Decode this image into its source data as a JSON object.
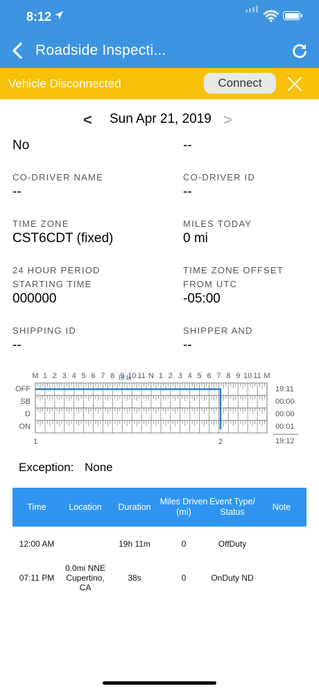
{
  "status_bar": {
    "time": "8:12"
  },
  "nav": {
    "title": "Roadside Inspecti..."
  },
  "banner": {
    "text": "Vehicle Disconnected",
    "connect_label": "Connect"
  },
  "date_nav": {
    "prev": "<",
    "date": "Sun Apr 21, 2019",
    "next": ">"
  },
  "fields": {
    "top_left_value": "No",
    "top_right_value": "--",
    "co_driver_name": {
      "label": "CO-DRIVER NAME",
      "value": "--"
    },
    "co_driver_id": {
      "label": "CO-DRIVER ID",
      "value": "--"
    },
    "time_zone": {
      "label": "TIME ZONE",
      "value": "CST6CDT (fixed)"
    },
    "miles_today": {
      "label": "MILES TODAY",
      "value": "0 mi"
    },
    "period_start": {
      "label1": "24 HOUR PERIOD",
      "label2": "STARTING TIME",
      "value": "000000"
    },
    "tz_offset": {
      "label1": "TIME ZONE OFFSET",
      "label2": "FROM UTC",
      "value": "-05:00"
    },
    "shipping_id": {
      "label": "SHIPPING ID",
      "value": "--"
    },
    "shipper": {
      "label": "SHIPPER AND",
      "value": "--"
    }
  },
  "graph": {
    "hour_labels": [
      "M",
      "1",
      "2",
      "3",
      "4",
      "5",
      "6",
      "7",
      "8",
      "9",
      "10",
      "11",
      "N",
      "1",
      "2",
      "3",
      "4",
      "5",
      "6",
      "7",
      "8",
      "9",
      "10",
      "11",
      "M"
    ],
    "rows": [
      "OFF",
      "SB",
      "D",
      "ON"
    ],
    "totals": [
      "19:11",
      "00:00",
      "00:00",
      "00:01"
    ],
    "total_sum": "19:12",
    "marker_label": "19:11",
    "markers": [
      "1",
      "2"
    ],
    "line_color": "#2a7bc8"
  },
  "exception": {
    "label": "Exception:",
    "value": "None"
  },
  "table": {
    "headers": [
      "Time",
      "Location",
      "Duration",
      "Miles Driven (mi)",
      "Event Type/ Status",
      "Note"
    ],
    "rows": [
      {
        "time": "12:00 AM",
        "location": "",
        "duration": "19h 11m",
        "miles": "0",
        "event": "OffDuty",
        "note": ""
      },
      {
        "time": "07:11 PM",
        "location": "0.0mi NNE Cupertino, CA",
        "duration": "38s",
        "miles": "0",
        "event": "OnDuty ND",
        "note": ""
      }
    ]
  }
}
